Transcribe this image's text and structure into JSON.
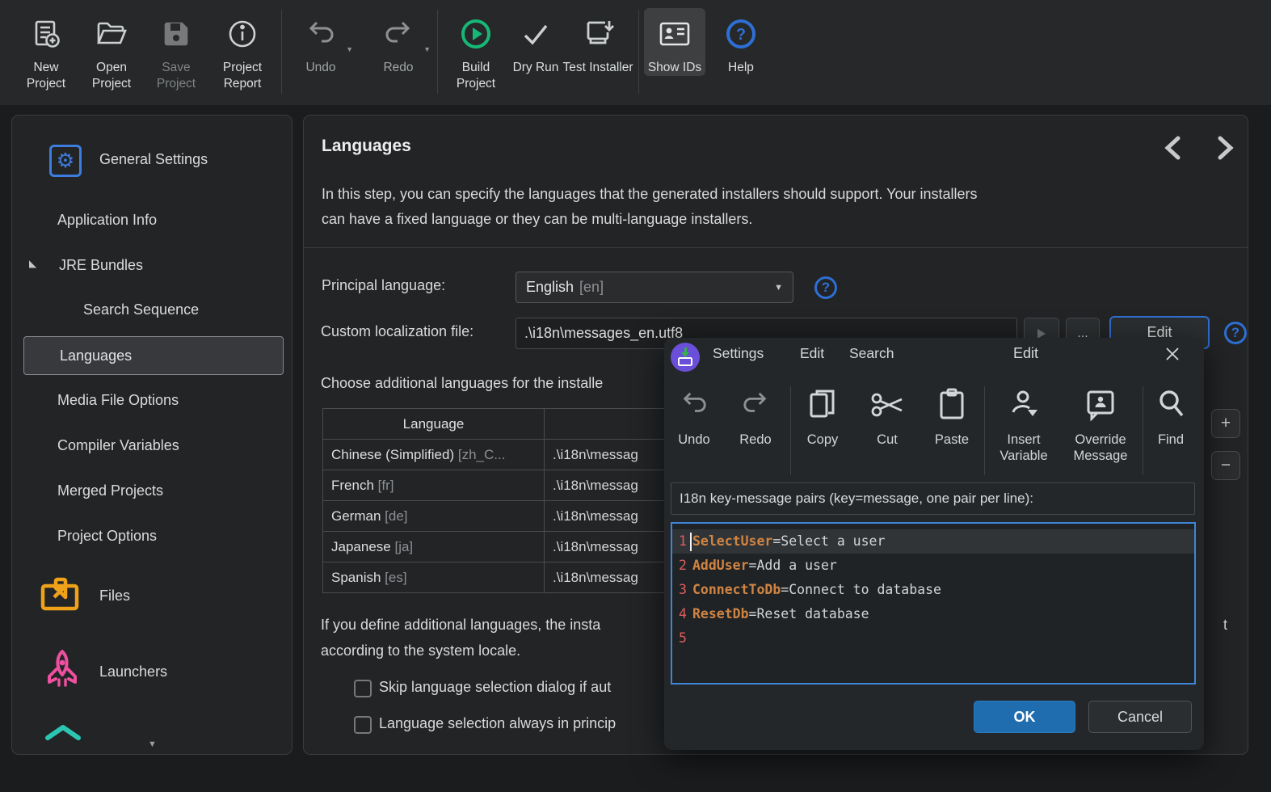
{
  "toolbar": {
    "items": [
      {
        "label": "New Project"
      },
      {
        "label": "Open Project"
      },
      {
        "label": "Save Project"
      },
      {
        "label": "Project Report"
      },
      {
        "label": "Undo"
      },
      {
        "label": "Redo"
      },
      {
        "label": "Build Project"
      },
      {
        "label": "Dry Run"
      },
      {
        "label": "Test Installer"
      },
      {
        "label": "Show IDs"
      },
      {
        "label": "Help"
      }
    ]
  },
  "sidebar": {
    "items": [
      {
        "label": "General Settings"
      },
      {
        "label": "Application Info"
      },
      {
        "label": "JRE Bundles"
      },
      {
        "label": "Search Sequence"
      },
      {
        "label": "Languages"
      },
      {
        "label": "Media File Options"
      },
      {
        "label": "Compiler Variables"
      },
      {
        "label": "Merged Projects"
      },
      {
        "label": "Project Options"
      },
      {
        "label": "Files"
      },
      {
        "label": "Launchers"
      }
    ]
  },
  "main": {
    "title": "Languages",
    "description_line1": "In this step, you can specify the languages that the generated installers should support. Your installers",
    "description_line2": "can have a fixed language or they can be multi-language installers.",
    "principal_language_label": "Principal language:",
    "principal_language_value": "English",
    "principal_language_code": "[en]",
    "custom_localization_label": "Custom localization file:",
    "custom_localization_value": ".\\i18n\\messages_en.utf8",
    "browse_button": "...",
    "edit_button": "Edit",
    "choose_text": "Choose additional languages for the installe",
    "table": {
      "header": "Language",
      "rows": [
        {
          "language": "Chinese (Simplified)",
          "code": "[zh_C...",
          "file": ".\\i18n\\messag"
        },
        {
          "language": "French",
          "code": "[fr]",
          "file": ".\\i18n\\messag"
        },
        {
          "language": "German",
          "code": "[de]",
          "file": ".\\i18n\\messag"
        },
        {
          "language": "Japanese",
          "code": "[ja]",
          "file": ".\\i18n\\messag"
        },
        {
          "language": "Spanish",
          "code": "[es]",
          "file": ".\\i18n\\messag"
        }
      ]
    },
    "note_line1": "If you define additional languages, the insta",
    "note_fragment": "t",
    "note_line2": "according to the system locale.",
    "checkbox1_label": "Skip language selection dialog if aut",
    "checkbox2_label": "Language selection always in princip",
    "add_button": "+",
    "remove_button": "−"
  },
  "dialog": {
    "menus": [
      "Settings",
      "Edit",
      "Search"
    ],
    "title": "Edit",
    "close": "✕",
    "toolbar": [
      {
        "label": "Undo"
      },
      {
        "label": "Redo"
      },
      {
        "label": "Copy"
      },
      {
        "label": "Cut"
      },
      {
        "label": "Paste"
      },
      {
        "label": "Insert Variable"
      },
      {
        "label": "Override Message"
      },
      {
        "label": "Find"
      }
    ],
    "editor_label": "I18n key-message pairs (key=message, one pair per line):",
    "editor_lines": [
      {
        "num": "1",
        "key": "SelectUser",
        "rest": "=Select a user"
      },
      {
        "num": "2",
        "key": "AddUser",
        "rest": "=Add a user"
      },
      {
        "num": "3",
        "key": "ConnectToDb",
        "rest": "=Connect to database"
      },
      {
        "num": "4",
        "key": "ResetDb",
        "rest": "=Reset database"
      },
      {
        "num": "5",
        "key": "",
        "rest": ""
      }
    ],
    "ok_button": "OK",
    "cancel_button": "Cancel"
  },
  "colors": {
    "accent_blue": "#3e7de0",
    "help_blue": "#2e6fd4",
    "build_green": "#17b877",
    "files_orange": "#f0a11a",
    "launcher_pink": "#ee4f9f",
    "teal": "#2cc5b2",
    "editor_border": "#3f85d8",
    "line_number_red": "#e05c5e",
    "key_orange": "#d08442",
    "ok_blue": "#1f6cae",
    "dialog_icon_purple": "#6a4fd8"
  }
}
